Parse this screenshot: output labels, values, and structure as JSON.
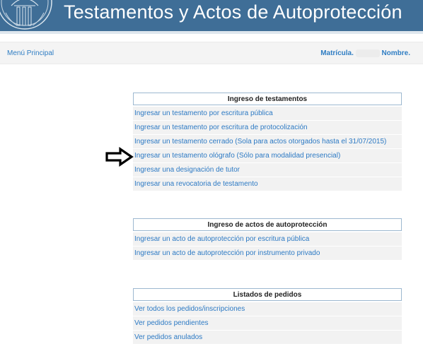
{
  "header": {
    "title": "Testamentos y Actos de Autoprotección"
  },
  "nav": {
    "menu_label": "Menú Principal",
    "matricula_label": "Matrícula.",
    "nombre_label": "Nombre."
  },
  "sections": [
    {
      "title": "Ingreso de testamentos",
      "items": [
        "Ingresar un testamento por escritura pública",
        "Ingresar un testamento por escritura de protocolización",
        "Ingresar un testamento cerrado (Sola para actos otorgados hasta el 31/07/2015)",
        "Ingresar un testamento ológrafo (Sólo para modalidad presencial)",
        "Ingresar una designación de tutor",
        "Ingresar una revocatoria de testamento"
      ]
    },
    {
      "title": "Ingreso de actos de autoprotección",
      "items": [
        "Ingresar un acto de autoprotección por escritura pública",
        "Ingresar un acto de autoprotección por instrumento privado"
      ]
    },
    {
      "title": "Listados de pedidos",
      "items": [
        "Ver todos los pedidos/inscripciones",
        "Ver pedidos pendientes",
        "Ver pedidos anulados"
      ]
    }
  ],
  "colors": {
    "header_bg": "#3f6e97",
    "link": "#2d7ac4",
    "row_bg": "#f2f2f2"
  },
  "icons": [
    "seal-logo-icon",
    "pointer-arrow-icon"
  ]
}
